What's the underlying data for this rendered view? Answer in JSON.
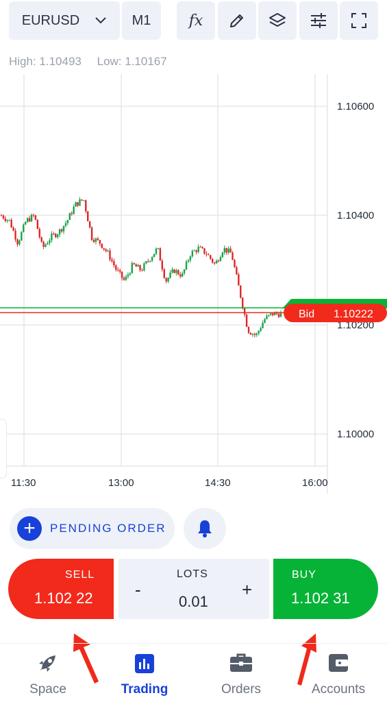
{
  "toolbar": {
    "symbol": "EURUSD",
    "timeframe": "M1",
    "icons": [
      "fx-icon",
      "pencil-icon",
      "layers-icon",
      "sliders-icon",
      "fullscreen-icon"
    ]
  },
  "stats": {
    "high": "High: 1.10493",
    "low": "Low: 1.10167"
  },
  "chart": {
    "price_labels": [
      "1.10600",
      "1.10400",
      "1.10200",
      "1.10000"
    ],
    "time_labels": [
      "11:30",
      "13:00",
      "14:30",
      "16:00"
    ],
    "bid_label": "Bid",
    "bid_value": "1.10222",
    "colors": {
      "up": "#16a34a",
      "down": "#dc2626",
      "bid": "#f22a1c",
      "ask_line": "#07b336"
    }
  },
  "chart_data": {
    "type": "candlestick",
    "y_range": [
      1.0995,
      1.1067
    ],
    "x_labels": [
      "11:30",
      "13:00",
      "14:30",
      "16:00"
    ],
    "bid": 1.10222,
    "ask": 1.10231,
    "high": 1.10493,
    "low": 1.10167,
    "close_path": [
      1.104,
      1.1039,
      1.1035,
      1.1039,
      1.104,
      1.1034,
      1.1036,
      1.1037,
      1.1039,
      1.1042,
      1.1043,
      1.1036,
      1.1035,
      1.1033,
      1.103,
      1.1028,
      1.1031,
      1.103,
      1.1032,
      1.1034,
      1.1028,
      1.103,
      1.1029,
      1.1033,
      1.1034,
      1.1033,
      1.1031,
      1.1034,
      1.1033,
      1.1026,
      1.1019,
      1.1018,
      1.1021,
      1.1022,
      1.1022
    ]
  },
  "actions": {
    "pending_label": "PENDING ORDER",
    "sell_label": "SELL",
    "sell_price": "1.102 22",
    "lots_label": "LOTS",
    "lots_value": "0.01",
    "minus": "-",
    "plus": "+",
    "buy_label": "BUY",
    "buy_price": "1.102 31"
  },
  "nav": [
    {
      "label": "Space",
      "icon": "rocket-icon"
    },
    {
      "label": "Trading",
      "icon": "chart-icon",
      "active": true
    },
    {
      "label": "Orders",
      "icon": "briefcase-icon"
    },
    {
      "label": "Accounts",
      "icon": "wallet-icon"
    }
  ]
}
